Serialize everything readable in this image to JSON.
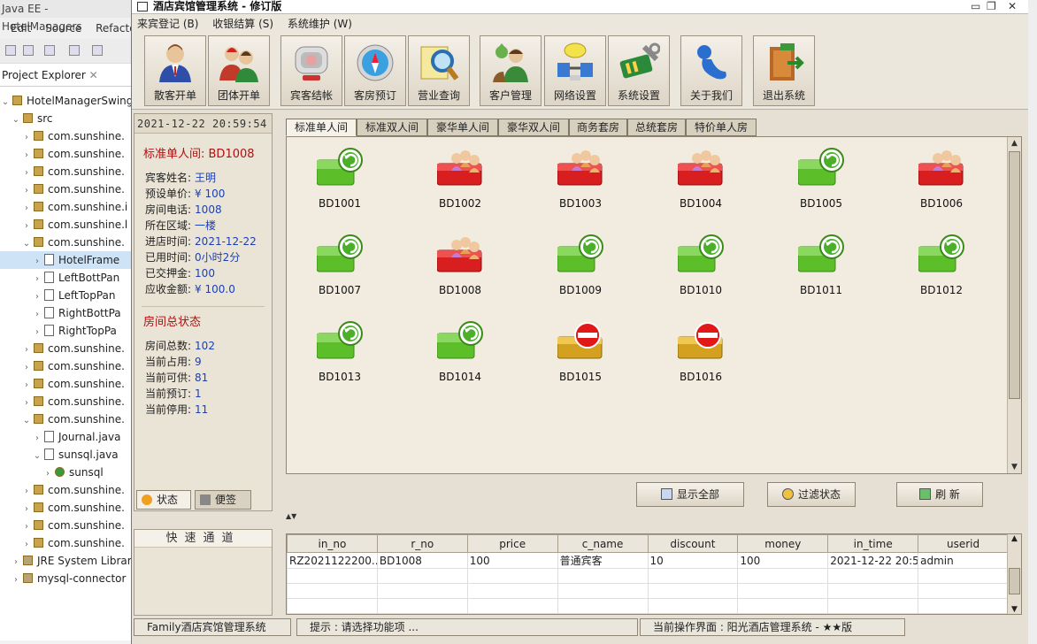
{
  "eclipse": {
    "title": "Java EE - HotelManagers",
    "menu": [
      "Edit",
      "Source",
      "Refacto"
    ],
    "project_explorer": "Project Explorer",
    "tree": [
      {
        "arrow": "v",
        "kind": "project",
        "label": "HotelManagerSwing",
        "indent": 0
      },
      {
        "arrow": "v",
        "kind": "src",
        "label": "src",
        "indent": 1
      },
      {
        "arrow": ">",
        "kind": "pkg",
        "label": "com.sunshine.",
        "indent": 2
      },
      {
        "arrow": ">",
        "kind": "pkg",
        "label": "com.sunshine.",
        "indent": 2
      },
      {
        "arrow": ">",
        "kind": "pkg",
        "label": "com.sunshine.",
        "indent": 2
      },
      {
        "arrow": ">",
        "kind": "pkg",
        "label": "com.sunshine.",
        "indent": 2
      },
      {
        "arrow": ">",
        "kind": "pkg",
        "label": "com.sunshine.i",
        "indent": 2
      },
      {
        "arrow": ">",
        "kind": "pkg",
        "label": "com.sunshine.l",
        "indent": 2
      },
      {
        "arrow": "v",
        "kind": "pkg",
        "label": "com.sunshine.",
        "indent": 2
      },
      {
        "arrow": ">",
        "kind": "java",
        "label": "HotelFrame",
        "indent": 3,
        "selected": true
      },
      {
        "arrow": ">",
        "kind": "java",
        "label": "LeftBottPan",
        "indent": 3
      },
      {
        "arrow": ">",
        "kind": "java",
        "label": "LeftTopPan",
        "indent": 3
      },
      {
        "arrow": ">",
        "kind": "java",
        "label": "RightBottPa",
        "indent": 3
      },
      {
        "arrow": ">",
        "kind": "java",
        "label": "RightTopPa",
        "indent": 3
      },
      {
        "arrow": ">",
        "kind": "pkg",
        "label": "com.sunshine.",
        "indent": 2
      },
      {
        "arrow": ">",
        "kind": "pkg",
        "label": "com.sunshine.",
        "indent": 2
      },
      {
        "arrow": ">",
        "kind": "pkg",
        "label": "com.sunshine.",
        "indent": 2
      },
      {
        "arrow": ">",
        "kind": "pkg",
        "label": "com.sunshine.",
        "indent": 2
      },
      {
        "arrow": "v",
        "kind": "pkg",
        "label": "com.sunshine.",
        "indent": 2
      },
      {
        "arrow": ">",
        "kind": "java",
        "label": "Journal.java",
        "indent": 3
      },
      {
        "arrow": "v",
        "kind": "java",
        "label": "sunsql.java",
        "indent": 3
      },
      {
        "arrow": ">",
        "kind": "class",
        "label": "sunsql",
        "indent": 4
      },
      {
        "arrow": ">",
        "kind": "pkg",
        "label": "com.sunshine.",
        "indent": 2
      },
      {
        "arrow": ">",
        "kind": "pkg",
        "label": "com.sunshine.",
        "indent": 2
      },
      {
        "arrow": ">",
        "kind": "pkg",
        "label": "com.sunshine.",
        "indent": 2
      },
      {
        "arrow": ">",
        "kind": "pkg",
        "label": "com.sunshine.",
        "indent": 2
      },
      {
        "arrow": ">",
        "kind": "lib",
        "label": "JRE System Librar",
        "indent": 1
      },
      {
        "arrow": ">",
        "kind": "lib",
        "label": "mysql-connector",
        "indent": 1
      }
    ]
  },
  "app": {
    "title": "酒店宾馆管理系统 - 修订版",
    "menu": [
      "来宾登记 (B)",
      "收银结算 (S)",
      "系统维护 (W)"
    ],
    "toolbar": [
      {
        "label": "散客开单",
        "icon": "guest-person-icon"
      },
      {
        "label": "团体开单",
        "icon": "group-people-icon"
      },
      {
        "label": "宾客结帐",
        "icon": "checkout-monitor-icon"
      },
      {
        "label": "客房预订",
        "icon": "compass-icon"
      },
      {
        "label": "营业查询",
        "icon": "magnifier-icon"
      },
      {
        "label": "客户管理",
        "icon": "customer-icon"
      },
      {
        "label": "网络设置",
        "icon": "network-icon"
      },
      {
        "label": "系统设置",
        "icon": "settings-tools-icon"
      },
      {
        "label": "关于我们",
        "icon": "about-icon"
      },
      {
        "label": "退出系统",
        "icon": "exit-door-icon"
      }
    ],
    "datetime": "2021-12-22 20:59:54",
    "room_info": {
      "heading": "标准单人间:  BD1008",
      "rows": [
        {
          "k": "宾客姓名:",
          "v": "王明"
        },
        {
          "k": "预设单价:",
          "v": "¥ 100"
        },
        {
          "k": "房间电话:",
          "v": "1008"
        },
        {
          "k": "所在区域:",
          "v": "一楼"
        },
        {
          "k": "进店时间:",
          "v": "2021-12-22"
        },
        {
          "k": "已用时间:",
          "v": "0小时2分"
        },
        {
          "k": "已交押金:",
          "v": "100"
        },
        {
          "k": "应收金额:",
          "v": "¥ 100.0"
        }
      ]
    },
    "room_summary": {
      "heading": "房间总状态",
      "rows": [
        {
          "k": "房间总数:",
          "v": "102"
        },
        {
          "k": "当前占用:",
          "v": "9"
        },
        {
          "k": "当前可供:",
          "v": "81"
        },
        {
          "k": "当前预订:",
          "v": "1"
        },
        {
          "k": "当前停用:",
          "v": "11"
        }
      ]
    },
    "left_tabs": [
      "状态",
      "便签"
    ],
    "quick_channel": "快速通道",
    "room_tabs": [
      "标准单人间",
      "标准双人间",
      "豪华单人间",
      "豪华双人间",
      "商务套房",
      "总统套房",
      "特价单人房"
    ],
    "rooms": [
      {
        "no": "BD1001",
        "status": "available"
      },
      {
        "no": "BD1002",
        "status": "occupied"
      },
      {
        "no": "BD1003",
        "status": "occupied"
      },
      {
        "no": "BD1004",
        "status": "occupied"
      },
      {
        "no": "BD1005",
        "status": "available"
      },
      {
        "no": "BD1006",
        "status": "occupied"
      },
      {
        "no": "BD1007",
        "status": "available"
      },
      {
        "no": "BD1008",
        "status": "occupied"
      },
      {
        "no": "BD1009",
        "status": "available"
      },
      {
        "no": "BD1010",
        "status": "available"
      },
      {
        "no": "BD1011",
        "status": "available"
      },
      {
        "no": "BD1012",
        "status": "available"
      },
      {
        "no": "BD1013",
        "status": "available"
      },
      {
        "no": "BD1014",
        "status": "available"
      },
      {
        "no": "BD1015",
        "status": "disabled"
      },
      {
        "no": "BD1016",
        "status": "disabled"
      }
    ],
    "actions": [
      "显示全部",
      "过滤状态",
      "刷  新"
    ],
    "table": {
      "columns": [
        "in_no",
        "r_no",
        "price",
        "c_name",
        "discount",
        "money",
        "in_time",
        "userid"
      ],
      "rows": [
        [
          "RZ2021122200...",
          "BD1008",
          "100",
          "普通宾客",
          "10",
          "100",
          "2021-12-22 20:5...",
          "admin"
        ]
      ]
    },
    "status": [
      "Family酒店宾馆管理系统",
      "提示 : 请选择功能项 ...",
      "当前操作界面 : 阳光酒店管理系统 - ★★版"
    ]
  }
}
